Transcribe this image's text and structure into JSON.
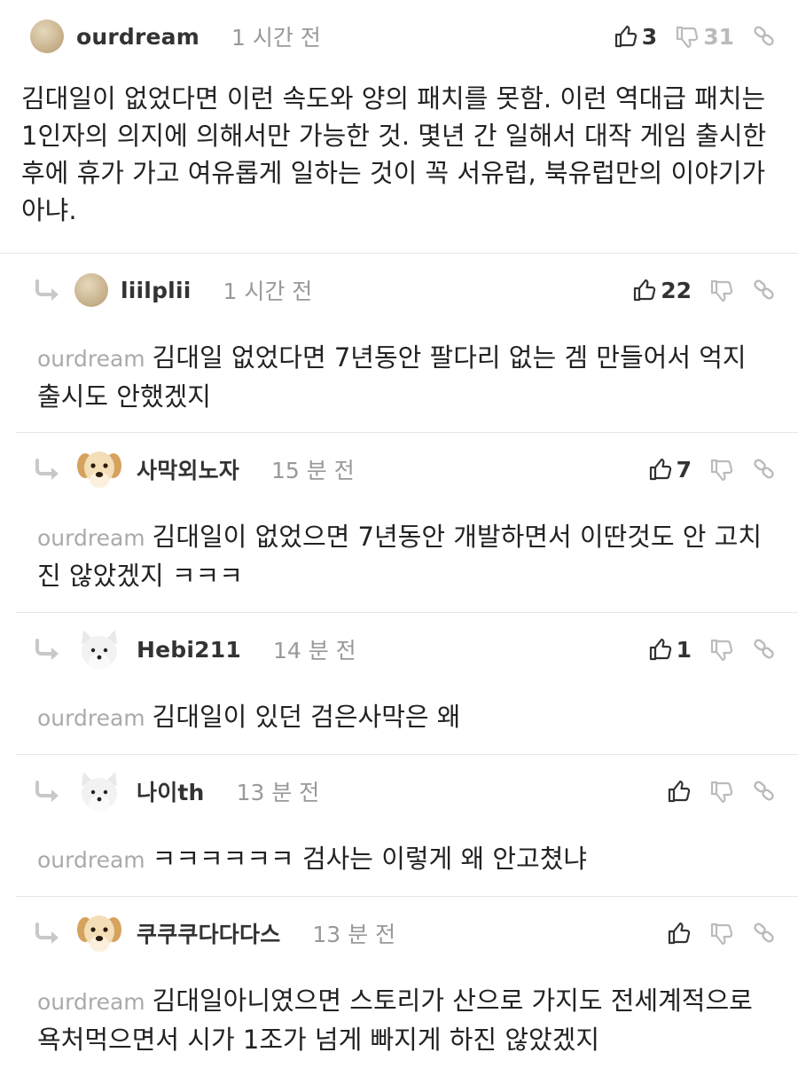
{
  "comments": [
    {
      "username": "ourdream",
      "time": "1 시간 전",
      "likes": "3",
      "dislikes": "31",
      "text": "김대일이 없었다면 이런 속도와 양의 패치를 못함. 이런 역대급 패치는 1인자의 의지에 의해서만 가능한 것. 몇년 간 일해서 대작 게임 출시한 후에 휴가 가고 여유롭게 일하는 것이 꼭 서유럽, 북유럽만의 이야기가 아냐."
    }
  ],
  "replies": [
    {
      "username": "liilplii",
      "time": "1 시간 전",
      "likes": "22",
      "mention": "ourdream",
      "text": "김대일 없었다면 7년동안 팔다리 없는 겜 만들어서 억지 출시도 안했겠지",
      "avatar": "beige-dot-avatar"
    },
    {
      "username": "사막외노자",
      "time": "15 분 전",
      "likes": "7",
      "mention": "ourdream",
      "text": "김대일이 없었으면 7년동안 개발하면서 이딴것도 안 고치진 않았겠지 ㅋㅋㅋ",
      "avatar": "puppy-avatar"
    },
    {
      "username": "Hebi211",
      "time": "14 분 전",
      "likes": "1",
      "mention": "ourdream",
      "text": "김대일이 있던 검은사막은 왜",
      "avatar": "white-fox-avatar"
    },
    {
      "username": "나이th",
      "time": "13 분 전",
      "likes": "",
      "mention": "ourdream",
      "text": "ㅋㅋㅋㅋㅋㅋ 검사는 이렇게 왜 안고쳤냐",
      "avatar": "white-fox-avatar"
    },
    {
      "username": "쿠쿠쿠다다다스",
      "time": "13 분 전",
      "likes": "",
      "mention": "ourdream",
      "text": "김대일아니였으면 스토리가 산으로 가지도 전세계적으로 욕처먹으면서 시가 1조가 넘게 빠지게 하진 않았겠지",
      "avatar": "puppy-avatar"
    }
  ],
  "icons": {
    "like": "thumbs-up-icon",
    "dislike": "thumbs-down-icon",
    "link": "link-icon",
    "reply": "reply-arrow-icon"
  }
}
